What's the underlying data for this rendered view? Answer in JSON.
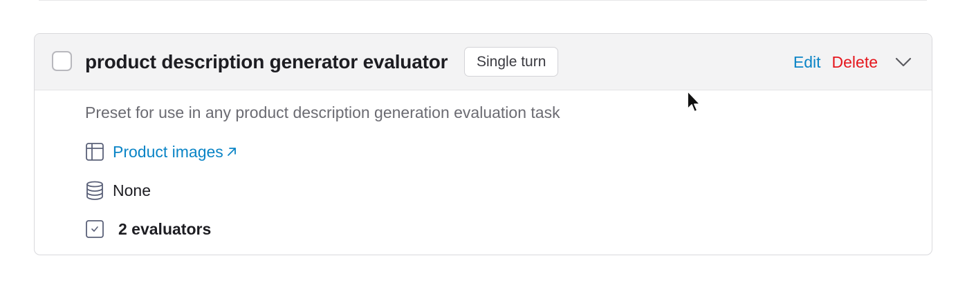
{
  "preset": {
    "title": "product description generator evaluator",
    "tag": "Single turn",
    "actions": {
      "edit_label": "Edit",
      "delete_label": "Delete"
    },
    "description": "Preset for use in any product description generation evaluation task",
    "dataset": {
      "icon": "table-icon",
      "label": "Product images",
      "link_icon": "external-link-arrow-icon"
    },
    "database": {
      "icon": "database-icon",
      "label": "None"
    },
    "evaluators": {
      "icon": "checkbox-square-icon",
      "label": "2 evaluators"
    },
    "checked": false,
    "expanded": true
  },
  "colors": {
    "link": "#0a84c6",
    "danger": "#e5161d",
    "header_bg": "#f3f3f4",
    "muted_text": "#6b6b72"
  }
}
